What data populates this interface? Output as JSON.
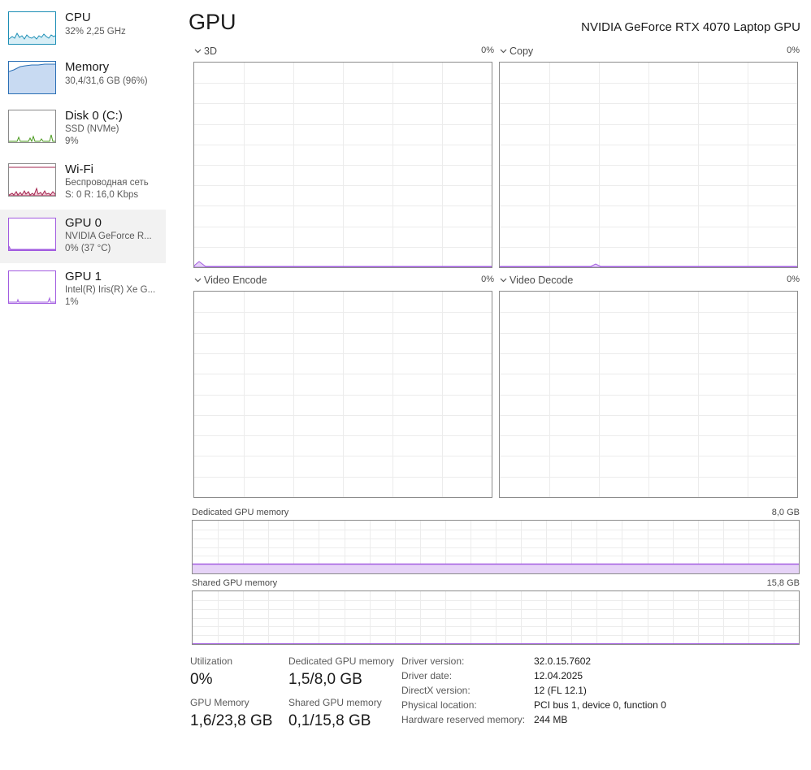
{
  "accent_color": "#a25ce0",
  "sidebar": {
    "items": [
      {
        "icon": "cpu-graph-icon",
        "title": "CPU",
        "sub1": "32%  2,25 GHz",
        "sub2": "",
        "color": "#1c8eb5",
        "selected": false
      },
      {
        "icon": "memory-graph-icon",
        "title": "Memory",
        "sub1": "30,4/31,6 GB (96%)",
        "sub2": "",
        "color": "#2a6fb5",
        "selected": false
      },
      {
        "icon": "disk-graph-icon",
        "title": "Disk 0 (C:)",
        "sub1": "SSD (NVMe)",
        "sub2": "9%",
        "color": "#4a9a1e",
        "selected": false
      },
      {
        "icon": "wifi-graph-icon",
        "title": "Wi-Fi",
        "sub1": "Беспроводная сеть",
        "sub2": "S: 0 R: 16,0 Kbps",
        "color": "#a3244f",
        "selected": false
      },
      {
        "icon": "gpu0-graph-icon",
        "title": "GPU 0",
        "sub1": "NVIDIA GeForce R...",
        "sub2": "0%  (37 °C)",
        "color": "#a25ce0",
        "selected": true
      },
      {
        "icon": "gpu1-graph-icon",
        "title": "GPU 1",
        "sub1": "Intel(R) Iris(R) Xe G...",
        "sub2": "1%",
        "color": "#a25ce0",
        "selected": false
      }
    ]
  },
  "header": {
    "title": "GPU",
    "gpu_name": "NVIDIA GeForce RTX 4070 Laptop GPU"
  },
  "engines": [
    {
      "name": "3D",
      "value": "0%"
    },
    {
      "name": "Copy",
      "value": "0%"
    },
    {
      "name": "Video Encode",
      "value": "0%"
    },
    {
      "name": "Video Decode",
      "value": "0%"
    }
  ],
  "dedicated_memory": {
    "label": "Dedicated GPU memory",
    "max": "8,0 GB",
    "fill_fraction": 0.19
  },
  "shared_memory": {
    "label": "Shared GPU memory",
    "max": "15,8 GB",
    "fill_fraction": 0.006
  },
  "stats": {
    "utilization_label": "Utilization",
    "utilization_value": "0%",
    "dedicated_label": "Dedicated GPU memory",
    "dedicated_value": "1,5/8,0 GB",
    "gpu_memory_label": "GPU Memory",
    "gpu_memory_value": "1,6/23,8 GB",
    "shared_label": "Shared GPU memory",
    "shared_value": "0,1/15,8 GB"
  },
  "info": [
    {
      "label": "Driver version:",
      "value": "32.0.15.7602"
    },
    {
      "label": "Driver date:",
      "value": "12.04.2025"
    },
    {
      "label": "DirectX version:",
      "value": "12 (FL 12.1)"
    },
    {
      "label": "Physical location:",
      "value": "PCI bus 1, device 0, function 0"
    },
    {
      "label": "Hardware reserved memory:",
      "value": "244 MB"
    }
  ]
}
